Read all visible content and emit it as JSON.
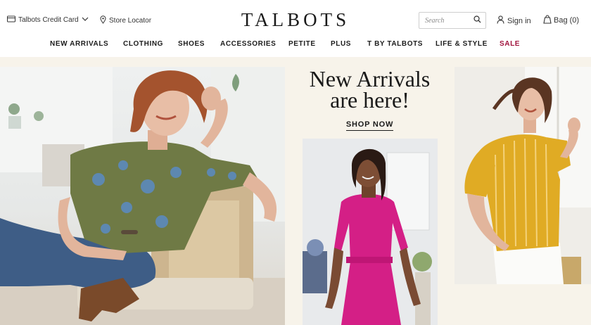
{
  "header": {
    "credit_card": "Talbots Credit Card",
    "store_locator": "Store Locator",
    "logo": "TALBOTS",
    "search_placeholder": "Search",
    "sign_in": "Sign in",
    "bag": "Bag (0)"
  },
  "nav": {
    "items": [
      "NEW ARRIVALS",
      "CLOTHING",
      "SHOES",
      "ACCESSORIES",
      "PETITE",
      "PLUS",
      "T BY TALBOTS",
      "LIFE & STYLE",
      "SALE"
    ]
  },
  "hero": {
    "headline_line1": "New Arrivals",
    "headline_line2": "are here!",
    "cta": "SHOP NOW"
  },
  "icons": [
    "credit-card-icon",
    "chevron-down-icon",
    "location-pin-icon",
    "search-icon",
    "user-icon",
    "shopping-bag-icon"
  ],
  "colors": {
    "sale": "#a0123c",
    "hero_bg": "#f7f3ea",
    "text": "#1a1a1a"
  }
}
